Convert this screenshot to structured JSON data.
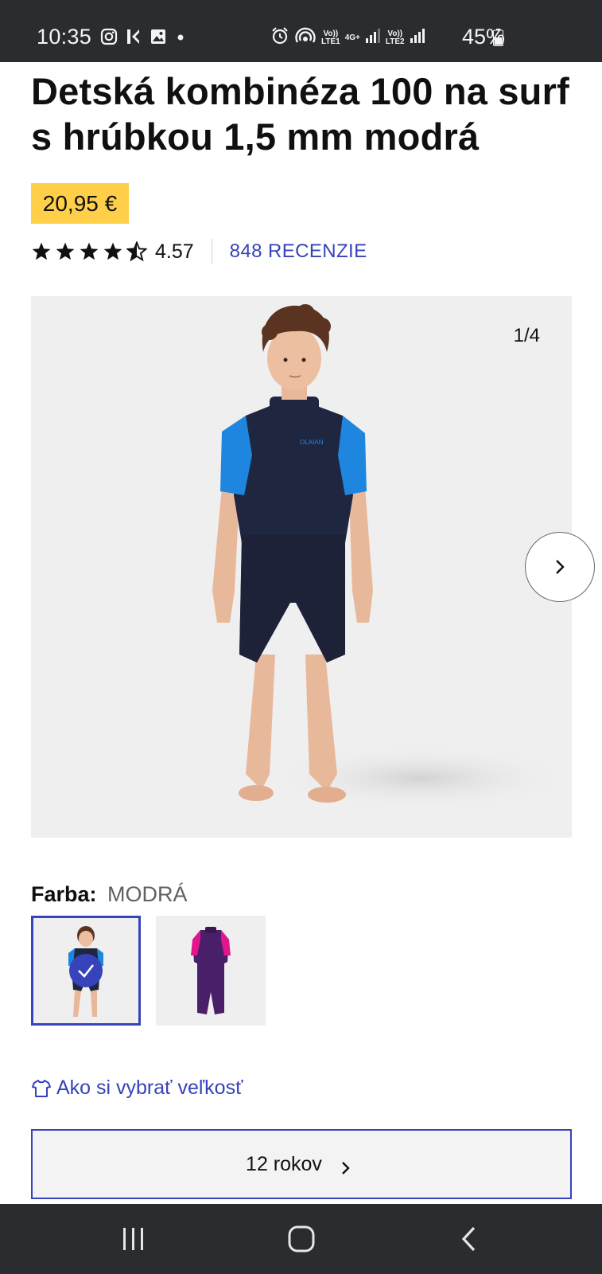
{
  "status_bar": {
    "time": "10:35",
    "left_icons": [
      "instagram-icon",
      "k-app-icon",
      "gallery-icon",
      "dot-icon"
    ],
    "right_icons": [
      "alarm-icon",
      "hotspot-icon",
      "volte1-icon",
      "4g-icon",
      "signal1-icon",
      "volte2-icon",
      "signal2-icon"
    ],
    "lte1": "Vo))\nLTE1",
    "net": "4G+",
    "lte2": "Vo))\nLTE2",
    "battery_percent": "45%",
    "battery_level": 0.45
  },
  "product": {
    "title": "Detská kombinéza 100 na surf s hrúbkou 1,5 mm modrá",
    "price": "20,95 €",
    "rating": {
      "value": "4.57",
      "stars_out_of_5": 4.57,
      "reviews_label": "848 RECENZIE"
    }
  },
  "gallery": {
    "counter": "1/4",
    "current": 1,
    "total": 4,
    "image_desc": "child-blue-wetsuit"
  },
  "color": {
    "label": "Farba:",
    "value": "MODRÁ",
    "swatches": [
      {
        "id": "blue",
        "selected": true
      },
      {
        "id": "purple",
        "selected": false
      }
    ]
  },
  "size_guide": {
    "label": "Ako si vybrať veľkosť",
    "icon": "tshirt-icon"
  },
  "size_select": {
    "value": "12 rokov",
    "icon": "chevron-right-icon"
  },
  "nav": {
    "buttons": [
      "recents-icon",
      "home-icon",
      "back-icon"
    ]
  },
  "colors": {
    "accent": "#3643ba",
    "price_bg": "#ffcf4a",
    "status_bg": "#2b2c30",
    "wetsuit_navy": "#1f2640",
    "wetsuit_blue": "#1f86e0",
    "wetsuit_purple": "#4a1f6a",
    "wetsuit_pink": "#e2158c"
  }
}
